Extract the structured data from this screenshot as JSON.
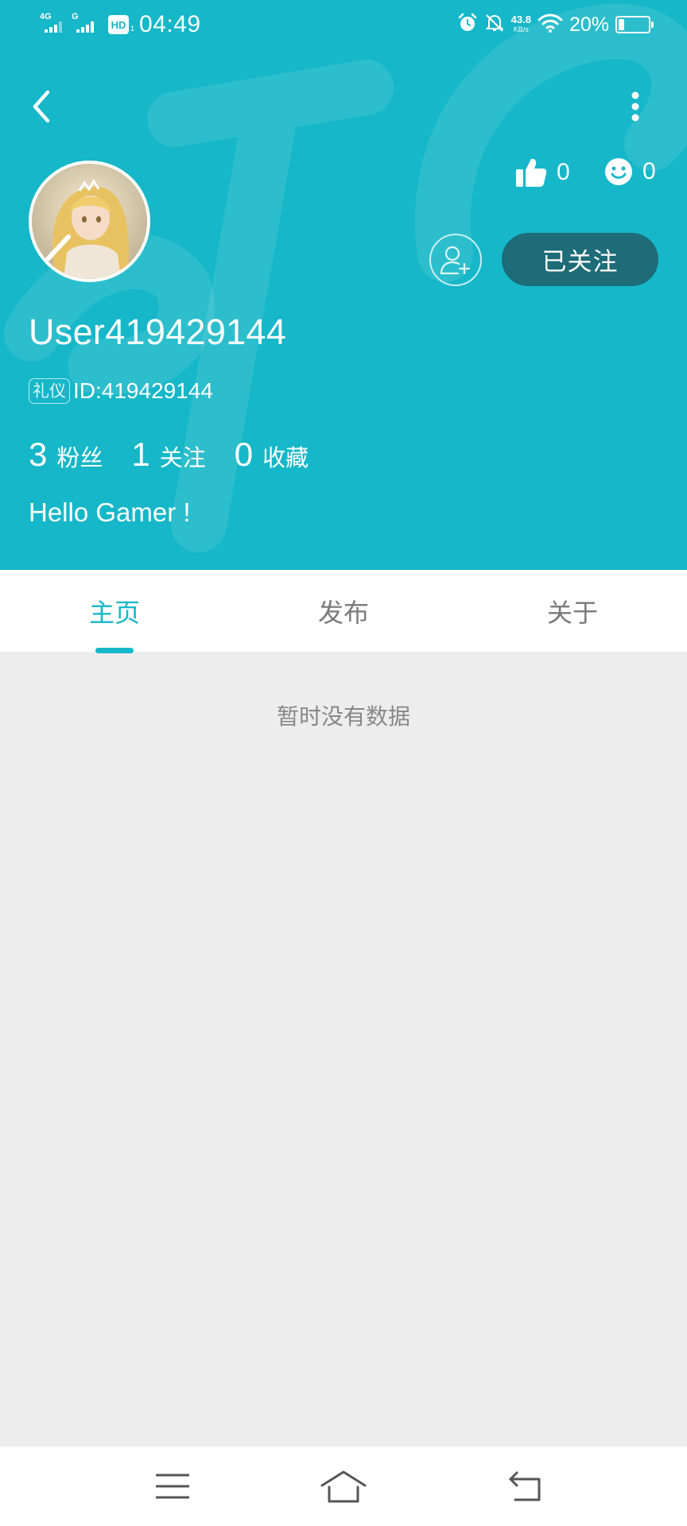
{
  "status_bar": {
    "network_1": "4G",
    "network_2": "G",
    "hd_label": "HD",
    "hd_sub": "1",
    "time": "04:49",
    "speed_value": "43.8",
    "speed_unit": "KB/s",
    "battery_percent": "20%",
    "battery_level": 0.2,
    "icons": [
      "signal-icon",
      "hd-icon",
      "alarm-icon",
      "mute-bell-icon",
      "wifi-icon",
      "battery-icon"
    ]
  },
  "header": {
    "back_icon": "chevron-left-icon",
    "more_icon": "more-vertical-icon",
    "likes_count": "0",
    "smiles_count": "0",
    "follow_button": "已关注",
    "username": "User419429144",
    "tag": "礼仪",
    "user_id": "ID:419429144",
    "stats": [
      {
        "value": "3",
        "label": "粉丝"
      },
      {
        "value": "1",
        "label": "关注"
      },
      {
        "value": "0",
        "label": "收藏"
      }
    ],
    "bio": "Hello Gamer !",
    "bg_color": "#15b7c8",
    "follow_color": "#1d6c78"
  },
  "tabs": [
    {
      "label": "主页",
      "active": true
    },
    {
      "label": "发布",
      "active": false
    },
    {
      "label": "关于",
      "active": false
    }
  ],
  "content": {
    "empty_message": "暂时没有数据"
  },
  "nav": {
    "icons": [
      "menu-icon",
      "home-icon",
      "back-icon"
    ]
  }
}
